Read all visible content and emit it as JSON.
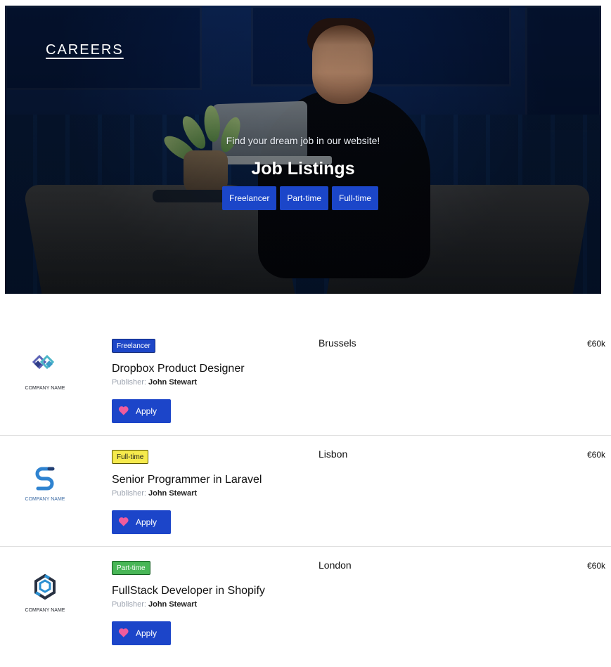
{
  "header": {
    "brand": "CAREERS",
    "subtitle": "Find your dream job in our website!",
    "title": "Job Listings"
  },
  "filters": [
    {
      "label": "Freelancer"
    },
    {
      "label": "Part-time"
    },
    {
      "label": "Full-time"
    }
  ],
  "jobs": [
    {
      "tag": "Freelancer",
      "tag_style": "freelancer",
      "title": "Dropbox Product Designer",
      "publisher_label": "Publisher:",
      "publisher_name": "John Stewart",
      "apply_label": "Apply",
      "location": "Brussels",
      "salary": "€60k",
      "logo_text": "COMPANY NAME",
      "logo_icon": "double-diamond-logo-icon"
    },
    {
      "tag": "Full-time",
      "tag_style": "fulltime",
      "title": "Senior Programmer in Laravel",
      "publisher_label": "Publisher:",
      "publisher_name": "John Stewart",
      "apply_label": "Apply",
      "location": "Lisbon",
      "salary": "€60k",
      "logo_text": "COMPANY NAME",
      "logo_icon": "s-curve-logo-icon"
    },
    {
      "tag": "Part-time",
      "tag_style": "parttime",
      "title": "FullStack Developer in Shopify",
      "publisher_label": "Publisher:",
      "publisher_name": "John Stewart",
      "apply_label": "Apply",
      "location": "London",
      "salary": "€60k",
      "logo_text": "COMPANY NAME",
      "logo_icon": "hexagon-logo-icon"
    }
  ],
  "colors": {
    "primary": "#1c45c9",
    "freelancer_tag": "#1d46c7",
    "fulltime_tag": "#f6ea4d",
    "parttime_tag": "#48b656",
    "heart": "#f05c9d"
  }
}
